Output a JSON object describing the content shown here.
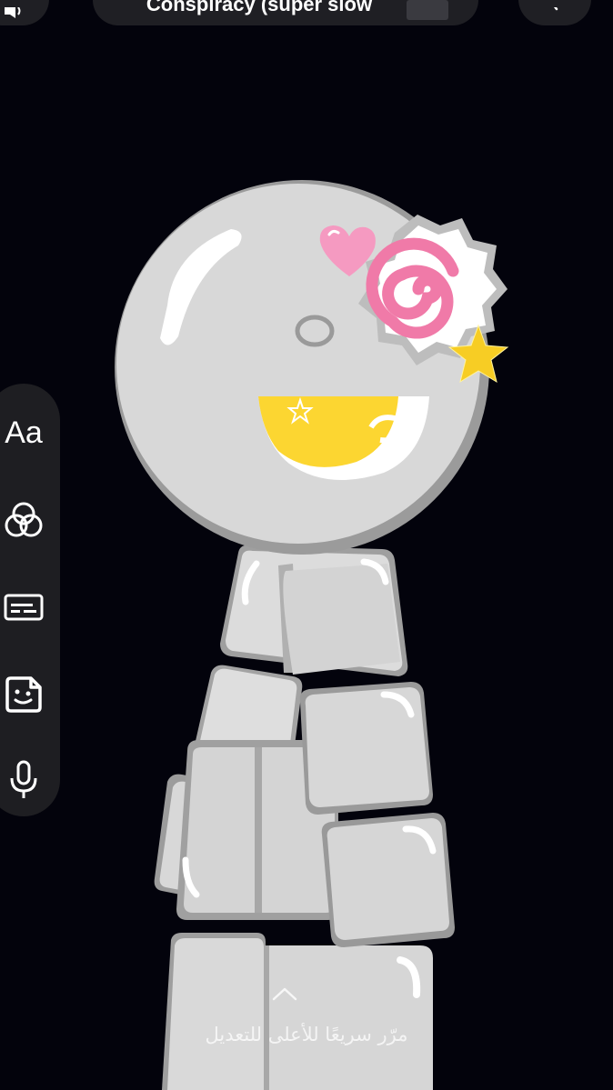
{
  "music": {
    "title": "Conspiracy (super slow",
    "thumbnail": "album-art"
  },
  "toolbar": {
    "text_tool_label": "Aa",
    "items": [
      "text-tool",
      "effects-icon",
      "captions-icon",
      "sticker-icon",
      "microphone-icon"
    ]
  },
  "hint": {
    "text": "مرّر سريعًا للأعلى للتعديل",
    "icon": "chevron-up-icon"
  },
  "colors": {
    "background": "#03030c",
    "toolbar": "#1e1e22",
    "avatar_body": "#d6d6d6",
    "smile": "#fcd631",
    "naruto": "#f07aa8",
    "star": "#f7cd24",
    "heart": "#f59ac1"
  }
}
